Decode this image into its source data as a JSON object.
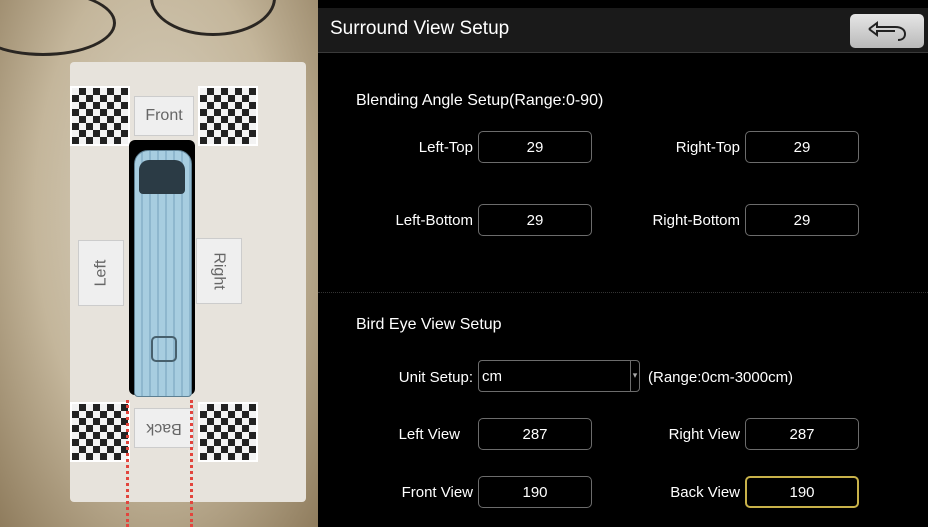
{
  "header": {
    "title": "Surround View Setup",
    "back_icon": "back-arrow-icon"
  },
  "preview": {
    "labels": {
      "front": "Front",
      "back": "Back",
      "left": "Left",
      "right": "Right"
    }
  },
  "blending": {
    "title": "Blending Angle Setup(Range:0-90)",
    "left_top": {
      "label": "Left-Top",
      "value": "29"
    },
    "right_top": {
      "label": "Right-Top",
      "value": "29"
    },
    "left_bottom": {
      "label": "Left-Bottom",
      "value": "29"
    },
    "right_bottom": {
      "label": "Right-Bottom",
      "value": "29"
    }
  },
  "bird_eye": {
    "title": "Bird Eye View Setup",
    "unit": {
      "label": "Unit Setup:",
      "value": "cm",
      "range": "(Range:0cm-3000cm)"
    },
    "left_view": {
      "label": "Left View",
      "value": "287"
    },
    "right_view": {
      "label": "Right View",
      "value": "287"
    },
    "front_view": {
      "label": "Front View",
      "value": "190"
    },
    "back_view": {
      "label": "Back View",
      "value": "190"
    }
  },
  "colors": {
    "active_border": "#c8b24a",
    "field_border": "#6c6c6c",
    "header_bg": "#1a1a1a"
  }
}
